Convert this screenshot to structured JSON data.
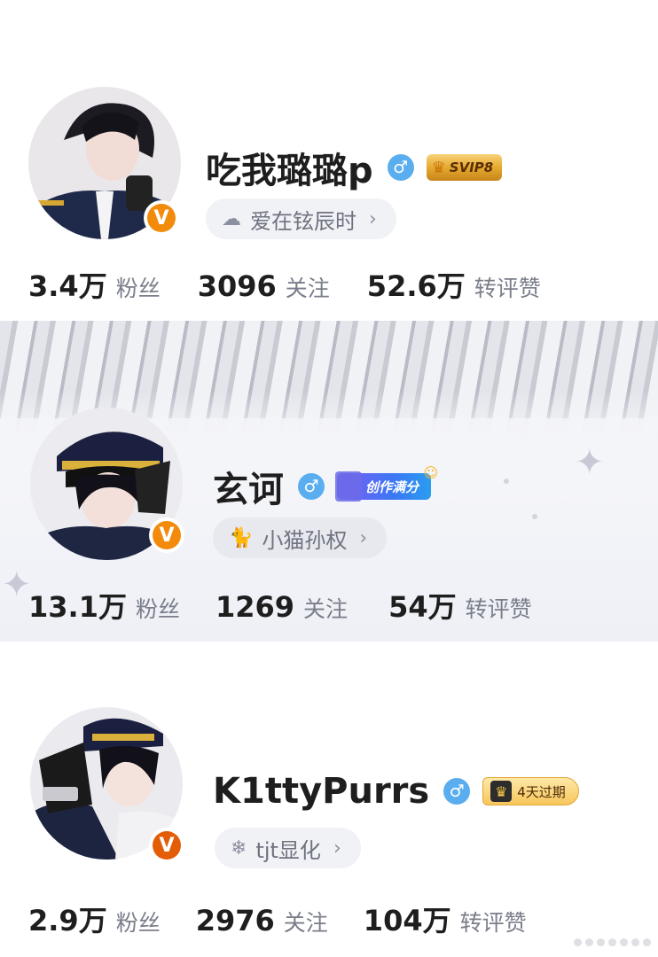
{
  "profiles": [
    {
      "name": "吃我璐璐p",
      "gender_icon": "♂",
      "badge": "SVIP8",
      "sub": {
        "icon": "cloud-icon",
        "glyph": "☁",
        "text": "爱在铉辰时",
        "chevron": "›"
      },
      "stats": [
        {
          "num": "3.4万",
          "label": "粉丝"
        },
        {
          "num": "3096",
          "label": "关注"
        },
        {
          "num": "52.6万",
          "label": "转评赞"
        }
      ],
      "verified_mark": "V"
    },
    {
      "name": "玄诃",
      "gender_icon": "♂",
      "badge": "创作满分",
      "sub": {
        "icon": "cat-icon",
        "glyph": "🐈",
        "text": "小猫孙权",
        "chevron": "›"
      },
      "stats": [
        {
          "num": "13.1万",
          "label": "粉丝"
        },
        {
          "num": "1269",
          "label": "关注"
        },
        {
          "num": "54万",
          "label": "转评赞"
        }
      ],
      "verified_mark": "V"
    },
    {
      "name": "K1ttyPurrs",
      "gender_icon": "♂",
      "badge": "4天过期",
      "sub": {
        "icon": "snowflake-icon",
        "glyph": "❄",
        "text": "tjt显化",
        "chevron": "›"
      },
      "stats": [
        {
          "num": "2.9万",
          "label": "粉丝"
        },
        {
          "num": "2976",
          "label": "关注"
        },
        {
          "num": "104万",
          "label": "转评赞"
        }
      ],
      "verified_mark": "V"
    }
  ],
  "colors": {
    "gender_blue": "#5aaef0",
    "verified_orange": "#f28b0b",
    "stat_label_gray": "#7a7e8a",
    "pill_bg": "#f1f2f6"
  }
}
